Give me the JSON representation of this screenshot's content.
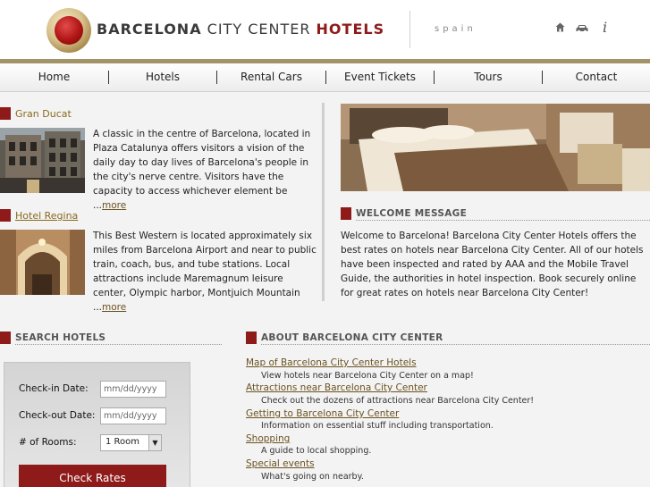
{
  "header": {
    "brand_part1": "BARCELONA",
    "brand_part2": " CITY CENTER ",
    "brand_part3": "HOTELS",
    "country": "spain",
    "icons": [
      "home-icon",
      "car-icon",
      "info-icon"
    ],
    "info_glyph": "i"
  },
  "nav": {
    "items": [
      "Home",
      "Hotels",
      "Rental Cars",
      "Event Tickets",
      "Tours",
      "Contact"
    ]
  },
  "hotels": [
    {
      "name": "Gran Ducat",
      "description": "A classic in the centre of Barcelona, located in Plaza Catalunya offers visitors a vision of the daily day to day lives of Barcelona's people in the city's nerve centre. Visitors have the capacity to access whichever element be ...",
      "more": "more"
    },
    {
      "name": "Hotel Regina",
      "description": "This Best Western is located approximately six miles from Barcelona Airport and near to public train, coach, bus, and tube stations. Local attractions include Maremagnum leisure center, Olympic harbor, Montjuich Mountain ...",
      "more": "more"
    }
  ],
  "welcome": {
    "title": "WELCOME MESSAGE",
    "text": "Welcome to Barcelona! Barcelona City Center Hotels offers the best rates on hotels near Barcelona City Center. All of our hotels have been inspected and rated by AAA and the Mobile Travel Guide, the authorities in hotel inspection. Book securely online for great rates on hotels near Barcelona City Center!"
  },
  "search": {
    "title": "SEARCH HOTELS",
    "checkin_label": "Check-in Date:",
    "checkin_placeholder": "mm/dd/yyyy",
    "checkout_label": "Check-out Date:",
    "checkout_placeholder": "mm/dd/yyyy",
    "rooms_label": "# of Rooms:",
    "rooms_value": "1 Room",
    "button": "Check Rates"
  },
  "about": {
    "title": "ABOUT BARCELONA CITY CENTER",
    "items": [
      {
        "link": "Map of Barcelona City Center Hotels",
        "desc": "View hotels near Barcelona City Center on a map!"
      },
      {
        "link": "Attractions near Barcelona City Center",
        "desc": "Check out the dozens of attractions near Barcelona City Center!"
      },
      {
        "link": "Getting to Barcelona City Center",
        "desc": "Information on essential stuff including transportation."
      },
      {
        "link": "Shopping",
        "desc": "A guide to local shopping."
      },
      {
        "link": "Special events",
        "desc": "What's going on nearby."
      }
    ]
  },
  "colors": {
    "accent": "#8e1a1a",
    "gold_band": "#a29468",
    "link": "#6b5220"
  }
}
